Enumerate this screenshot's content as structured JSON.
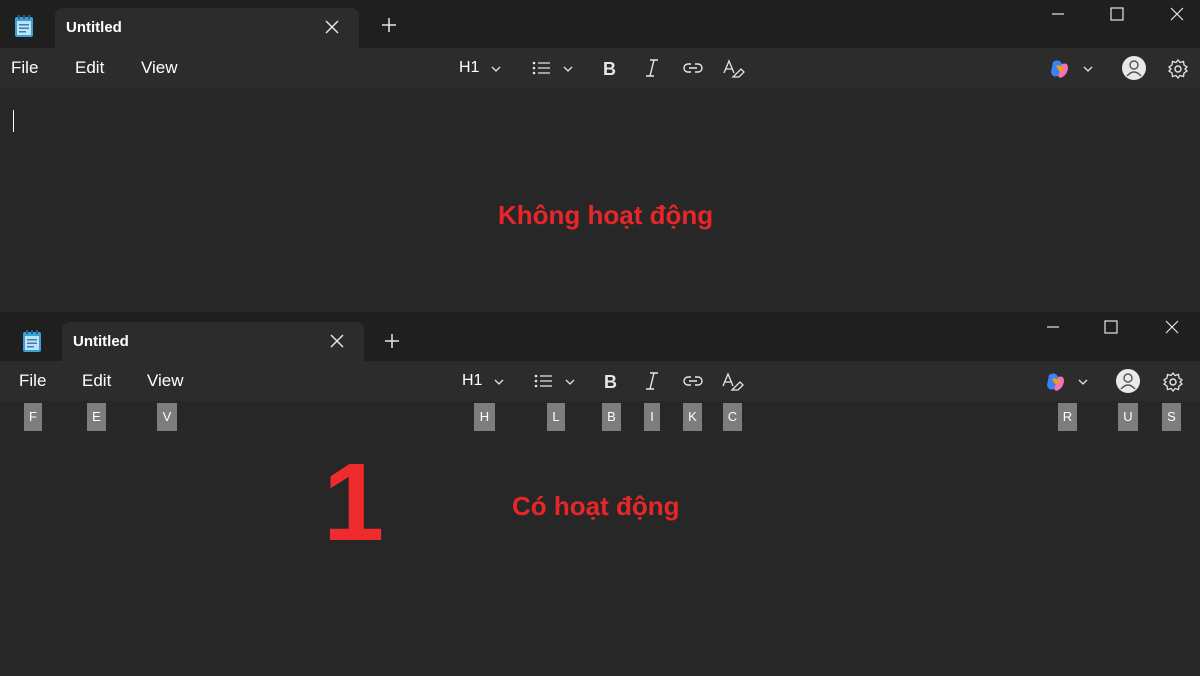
{
  "windows": {
    "inactive": {
      "tab_title": "Untitled",
      "status": "Không hoạt động"
    },
    "active": {
      "tab_title": "Untitled",
      "status": "Có hoạt động",
      "step": "1",
      "key_tips": {
        "file": "F",
        "edit": "E",
        "view": "V",
        "heading": "H",
        "list": "L",
        "bold": "B",
        "italic": "I",
        "link": "K",
        "clear": "C",
        "copilot": "R",
        "account": "U",
        "settings": "S"
      }
    }
  },
  "menu": {
    "file": "File",
    "edit": "Edit",
    "view": "View"
  },
  "toolbar": {
    "heading": "H1"
  },
  "icons": [
    "notepad-icon",
    "close-icon",
    "plus-icon",
    "minimize-icon",
    "maximize-icon",
    "chevron-down-icon",
    "list-icon",
    "bold-icon",
    "italic-icon",
    "link-icon",
    "clear-formatting-icon",
    "copilot-icon",
    "avatar-icon",
    "gear-icon"
  ],
  "colors": {
    "background": "#272727",
    "titlebar": "#1f1f1f",
    "tab": "#2c2c2c",
    "annotation_red": "#e8262a",
    "key_tip": "#7d7d7d"
  }
}
